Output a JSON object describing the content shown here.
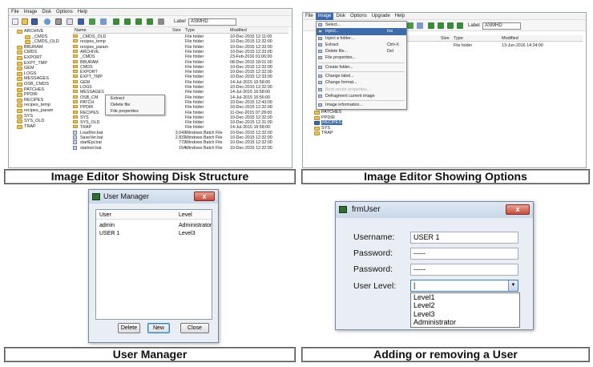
{
  "editor1": {
    "menu": [
      "File",
      "Image",
      "Disk",
      "Options",
      "Help"
    ],
    "label_caption": "Label",
    "label_value": "ASMHD",
    "tree": [
      "ARCHIVE",
      "_CMDS",
      "_CMDS_OLD",
      "BBURAM",
      "CMDS",
      "EXPORT",
      "EXPT_TMP",
      "GEM",
      "LOGS",
      "MESSAGES",
      "OSB_CMDS",
      "PATCHES",
      "PPDIR",
      "RECIPES",
      "recipes_temp",
      "recipes_param",
      "SYS",
      "SYS_OLD",
      "TRAP"
    ],
    "columns": {
      "name": "Name",
      "size": "Size",
      "type": "Type",
      "modified": "Modified"
    },
    "rows": [
      {
        "name": "_CMDS_OLD",
        "size": "",
        "type": "File folder",
        "modified": "10-Dec-2015 12:11:00",
        "icon": "folder"
      },
      {
        "name": "recipes_temp",
        "size": "",
        "type": "File folder",
        "modified": "10-Dec-2015 12:32:00",
        "icon": "folder"
      },
      {
        "name": "recipes_param",
        "size": "",
        "type": "File folder",
        "modified": "10-Dec-2015 12:32:00",
        "icon": "folder"
      },
      {
        "name": "ARCHIVE",
        "size": "",
        "type": "File folder",
        "modified": "10-Dec-2015 12:33:00",
        "icon": "folder"
      },
      {
        "name": "_CMDS",
        "size": "",
        "type": "File folder",
        "modified": "23-Feb-2016 01:06:00",
        "icon": "folder"
      },
      {
        "name": "BBURAM",
        "size": "",
        "type": "File folder",
        "modified": "08-Dec-2015 18:01:00",
        "icon": "folder"
      },
      {
        "name": "CMDS",
        "size": "",
        "type": "File folder",
        "modified": "10-Dec-2015 12:32:00",
        "icon": "folder"
      },
      {
        "name": "EXPORT",
        "size": "",
        "type": "File folder",
        "modified": "10-Dec-2015 12:32:00",
        "icon": "folder"
      },
      {
        "name": "EXPT_TMP",
        "size": "",
        "type": "File folder",
        "modified": "10-Dec-2015 12:33:00",
        "icon": "folder"
      },
      {
        "name": "GEM",
        "size": "",
        "type": "File folder",
        "modified": "14-Jul-2015 16:58:00",
        "icon": "folder"
      },
      {
        "name": "LOGS",
        "size": "",
        "type": "File folder",
        "modified": "10-Dec-2015 12:32:00",
        "icon": "folder"
      },
      {
        "name": "MESSAGES",
        "size": "",
        "type": "File folder",
        "modified": "14-Jul-2015 16:58:00",
        "icon": "folder"
      },
      {
        "name": "OSB_CM",
        "size": "",
        "type": "File folder",
        "modified": "14-Jul-2015 16:56:00",
        "icon": "folder"
      },
      {
        "name": "PATCH",
        "size": "",
        "type": "File folder",
        "modified": "10-Dec-2015 12:43:00",
        "icon": "folder"
      },
      {
        "name": "PPDIR",
        "size": "",
        "type": "File folder",
        "modified": "10-Dec-2015 12:32:00",
        "icon": "folder"
      },
      {
        "name": "RECIPES",
        "size": "",
        "type": "File folder",
        "modified": "11-Dec-2015 07:28:00",
        "icon": "folder"
      },
      {
        "name": "SYS",
        "size": "",
        "type": "File folder",
        "modified": "10-Dec-2015 12:32:00",
        "icon": "folder"
      },
      {
        "name": "SYS_OLD",
        "size": "",
        "type": "File folder",
        "modified": "10-Dec-2015 12:31:00",
        "icon": "folder"
      },
      {
        "name": "TRAP",
        "size": "",
        "type": "File folder",
        "modified": "14-Jul-2015 16:58:00",
        "icon": "folder"
      },
      {
        "name": "LoadVer.bat",
        "size": "3,042",
        "type": "Windows Batch File",
        "modified": "10-Dec-2015 12:32:00",
        "icon": "bat"
      },
      {
        "name": "SaveVer.bat",
        "size": "2,831",
        "type": "Windows Batch File",
        "modified": "10-Dec-2015 12:32:00",
        "icon": "bat"
      },
      {
        "name": "startEpi.bat",
        "size": "772",
        "type": "Windows Batch File",
        "modified": "10-Dec-2015 12:32:00",
        "icon": "bat"
      },
      {
        "name": "startnet.bat",
        "size": "154",
        "type": "Windows Batch File",
        "modified": "10-Dec-2015 12:32:00",
        "icon": "bat"
      }
    ],
    "context_menu": [
      "Extract",
      "Delete file",
      "File properties"
    ],
    "caption": "Image Editor Showing Disk Structure"
  },
  "editor2": {
    "menu": [
      "File",
      "Image",
      "Disk",
      "Options",
      "Upgrade",
      "Help"
    ],
    "label_caption": "Label",
    "label_value": "ASMHD",
    "columns": {
      "size": "Size",
      "type": "Type",
      "modified": "Modified"
    },
    "row": {
      "type": "File folder",
      "modified": "13-Jun-2016 14:24:00"
    },
    "tree": [
      "PATCHES",
      "PPDIR",
      "RECIPES",
      "SYS",
      "TRAP"
    ],
    "menu_items": [
      {
        "label": "Select...",
        "shortcut": ""
      },
      {
        "label": "Inject...",
        "shortcut": "Ins"
      },
      {
        "label": "Inject a folder...",
        "shortcut": ""
      },
      {
        "label": "Extract",
        "shortcut": "Ctrl+X"
      },
      {
        "label": "Delete file...",
        "shortcut": "Del"
      },
      {
        "label": "File properties...",
        "shortcut": ""
      },
      {
        "label": "Create folder...",
        "shortcut": ""
      },
      {
        "label": "Change label...",
        "shortcut": ""
      },
      {
        "label": "Change format...",
        "shortcut": ""
      },
      {
        "label": "Boot sector properties...",
        "shortcut": ""
      },
      {
        "label": "Defragment current image",
        "shortcut": ""
      },
      {
        "label": "Image information...",
        "shortcut": ""
      }
    ],
    "caption": "Image Editor Showing Options"
  },
  "user_manager": {
    "title": "User Manager",
    "close_glyph": "x",
    "columns": {
      "user": "User",
      "level": "Level"
    },
    "rows": [
      {
        "user": "admin",
        "level": "Administrator"
      },
      {
        "user": "USER 1",
        "level": "Level3"
      }
    ],
    "buttons": {
      "delete": "Delete",
      "new": "New",
      "close": "Close"
    },
    "caption": "User Manager"
  },
  "frm_user": {
    "title": "frmUser",
    "close_glyph": "x",
    "username_label": "Username:",
    "username_value": "USER 1",
    "password_label": "Password:",
    "password_value": "-----",
    "password2_label": "Password:",
    "password2_value": "-----",
    "level_label": "User Level:",
    "level_value": "|",
    "level_options": [
      "Level1",
      "Level2",
      "Level3",
      "Administrator"
    ],
    "caption": "Adding or removing a User"
  },
  "colors": {
    "accent": "#3d6aa8",
    "folder": "#e8c35a",
    "close": "#c84d3b"
  }
}
